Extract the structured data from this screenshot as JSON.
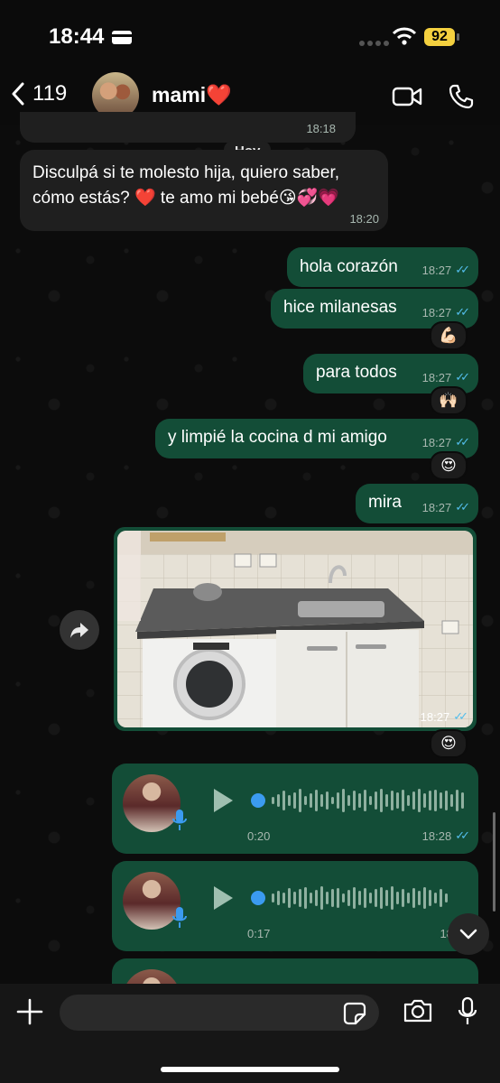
{
  "status": {
    "time": "18:44",
    "battery": "92"
  },
  "header": {
    "back_count": "119",
    "contact_name": "mami❤️"
  },
  "partial_time": "18:18",
  "day_chip": "Hoy",
  "incoming": {
    "text": "Disculpá si te molesto hija, quiero saber, cómo estás? ❤️ te amo mi bebé😘💞💗",
    "line1": "Disculpá si te molesto hija, quiero saber,",
    "line2": "cómo estás? ❤️ te amo mi bebé😘💞💗",
    "time": "18:20"
  },
  "outgoing": [
    {
      "text": "hola corazón",
      "time": "18:27"
    },
    {
      "text": "hice milanesas",
      "time": "18:27",
      "reaction": "💪🏻"
    },
    {
      "text": "para todos",
      "time": "18:27",
      "reaction": "🙌🏻"
    },
    {
      "text": "y limpié la cocina d mi amigo",
      "time": "18:27",
      "reaction": "😍"
    },
    {
      "text": "mira",
      "time": "18:27"
    }
  ],
  "photo": {
    "time": "18:27",
    "reaction": "😍"
  },
  "voice_notes": [
    {
      "duration": "0:20",
      "time": "18:28"
    },
    {
      "duration": "0:17",
      "time": "18:28"
    }
  ],
  "icons": {
    "back": "chevron-left-icon",
    "video": "video-call-icon",
    "phone": "phone-icon",
    "forward": "forward-icon",
    "play": "play-icon",
    "mic": "microphone-icon",
    "plus": "plus-icon",
    "sticker": "sticker-icon",
    "camera": "camera-icon",
    "scroll": "chevron-down-icon"
  },
  "colors": {
    "outgoing_bubble": "#134d37",
    "incoming_bubble": "#1f1f1f",
    "ticks": "#53bdeb"
  }
}
